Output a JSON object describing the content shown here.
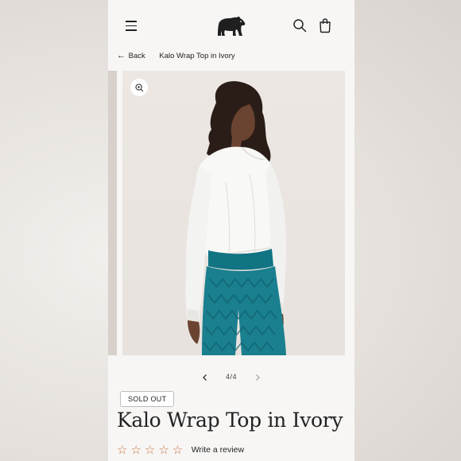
{
  "header": {
    "menu_icon": "hamburger-menu-icon",
    "logo_icon": "bear-logo-icon",
    "search_icon": "search-icon",
    "cart_icon": "shopping-bag-icon"
  },
  "breadcrumb": {
    "back_label": "Back",
    "back_icon": "←",
    "current": "Kalo Wrap Top in Ivory"
  },
  "gallery": {
    "zoom_icon": "zoom-in-icon",
    "current": "4",
    "total": "4",
    "counter": "4/4",
    "prev_icon": "‹",
    "next_icon": "›"
  },
  "product": {
    "badge": "SOLD OUT",
    "title": "Kalo Wrap Top in Ivory",
    "rating": 0,
    "max_rating": 5,
    "stars": "☆☆☆☆☆",
    "review_link": "Write a review"
  },
  "colors": {
    "accent_star": "#c9703f",
    "text": "#222222",
    "image_bg": "#ece7e3",
    "pants": "#1a7f8e"
  }
}
